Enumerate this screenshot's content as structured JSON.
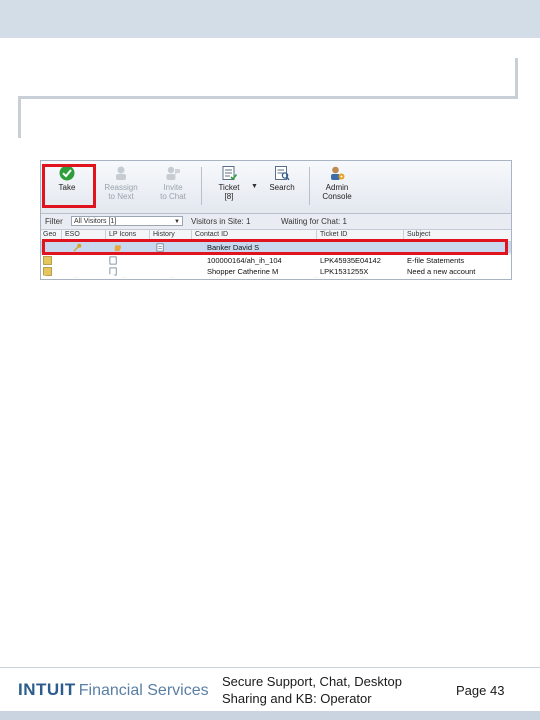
{
  "toolbar": {
    "buttons": [
      {
        "label": "Take",
        "enabled": true,
        "icon": "green-check-icon"
      },
      {
        "label": "Reassign\nto Next",
        "enabled": false,
        "icon": "reassign-icon"
      },
      {
        "label": "Invite\nto Chat",
        "enabled": false,
        "icon": "invite-icon"
      },
      {
        "label": "Ticket\n[8]",
        "enabled": true,
        "icon": "ticket-icon"
      },
      {
        "label": "Search",
        "enabled": true,
        "icon": "search-icon"
      },
      {
        "label": "Admin\nConsole",
        "enabled": true,
        "icon": "admin-icon"
      }
    ]
  },
  "filter": {
    "label": "Filter",
    "selected": "All Visitors [1]",
    "visitors_in_site": "Visitors in Site: 1",
    "waiting_for_chat": "Waiting for Chat: 1"
  },
  "table": {
    "headers": [
      "Geo",
      "ESO",
      "LP Icons",
      "History",
      "Contact ID",
      "Ticket ID",
      "Subject"
    ],
    "rows": [
      {
        "contact": "Banker David S",
        "ticket": "",
        "subject": "",
        "selected": true
      },
      {
        "contact": "100000164/ah_ih_104",
        "ticket": "LPK45935E04142",
        "subject": "E-file Statements",
        "selected": false
      },
      {
        "contact": "Shopper Catherine M",
        "ticket": "LPK1531255X",
        "subject": "Need a new account",
        "selected": false
      }
    ]
  },
  "footer": {
    "brand": "INTUIT",
    "division": "Financial Services",
    "title": "Secure Support, Chat, Desktop\nSharing and KB: Operator",
    "page": "Page 43"
  },
  "colors": {
    "highlight": "#e0141e",
    "brand": "#2b5c8c"
  }
}
